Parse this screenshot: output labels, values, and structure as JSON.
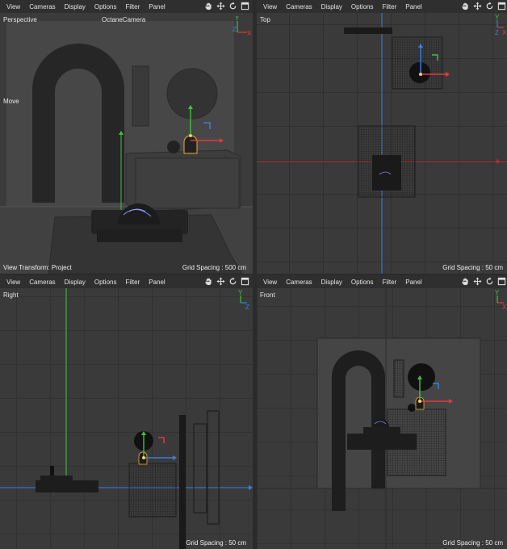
{
  "menu": [
    "View",
    "Cameras",
    "Display",
    "Options",
    "Filter",
    "Panel"
  ],
  "nav_icons": [
    "hand-pan-icon",
    "move-arrows-icon",
    "rotate-icon",
    "maximize-icon"
  ],
  "viewports": {
    "perspective": {
      "label": "Perspective",
      "camera": "OctaneCamera",
      "tool": "Move",
      "view_transform": "View Transform: Project",
      "grid_spacing": "Grid Spacing : 500 cm"
    },
    "top": {
      "label": "Top",
      "grid_spacing": "Grid Spacing : 50 cm"
    },
    "right": {
      "label": "Right",
      "grid_spacing": "Grid Spacing : 50 cm"
    },
    "front": {
      "label": "Front",
      "grid_spacing": "Grid Spacing : 50 cm"
    }
  },
  "axis_letters": {
    "y": "Y",
    "z": "Z",
    "x": "X"
  },
  "colors": {
    "x_axis": "#e33b3b",
    "y_axis": "#3ec43e",
    "z_axis": "#3b7ee0",
    "bg": "#3a3a3a"
  }
}
